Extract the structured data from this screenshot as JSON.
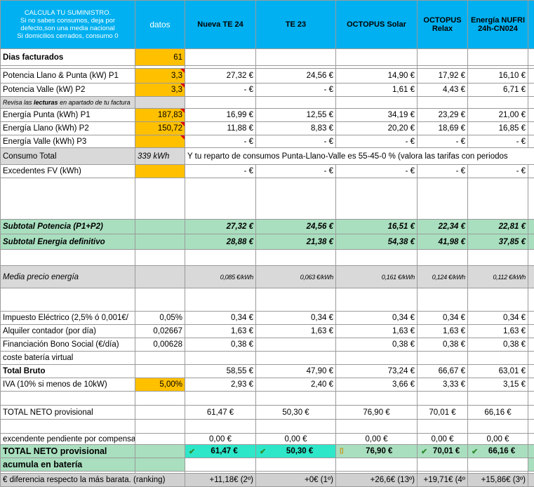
{
  "header": {
    "intro_lines": [
      "CALCULA TU SUMINISTRO.",
      "Si no sabes consumos, deja por",
      "defecto,son una media nacional",
      "Si domicilios cerrados, consumo 0"
    ],
    "datos": "datos",
    "providers": [
      "Nueva TE 24",
      "TE 23",
      "OCTOPUS  Solar",
      "OCTOPUS Relax",
      "Energía NUFRI 24h-CN024"
    ]
  },
  "rows": {
    "dias": {
      "label": "Dias facturados",
      "value": "61"
    },
    "p1": {
      "label": "Potencia Llano & Punta (kW) P1",
      "value": "3,3",
      "prices": [
        "27,32 €",
        "24,56 €",
        "14,90 €",
        "17,92 €",
        "16,10 €"
      ]
    },
    "p2": {
      "label": "Potencia Valle (kW) P2",
      "value": "3,3",
      "prices": [
        "-      €",
        "-      €",
        "1,61 €",
        "4,43 €",
        "6,71 €"
      ]
    },
    "note": {
      "prefix": "Revisa las",
      "bold": "lecturas",
      "suffix": "en apartado de tu factura"
    },
    "e1": {
      "label": "Energía Punta (kWh) P1",
      "value": "187,83",
      "prices": [
        "16,99 €",
        "12,55 €",
        "34,19 €",
        "23,29 €",
        "21,00 €"
      ]
    },
    "e2": {
      "label": "Energía Llano (kWh) P2",
      "value": "150,72",
      "prices": [
        "11,88 €",
        "8,83 €",
        "20,20 €",
        "18,69 €",
        "16,85 €"
      ]
    },
    "e3": {
      "label": "Energía Valle (kWh) P3",
      "value": "",
      "prices": [
        "-      €",
        "-      €",
        "-      €",
        "-      €",
        "-      €"
      ]
    },
    "consumo": {
      "label": "Consumo Total",
      "kwh": "339 kWh",
      "text": "Y tu reparto de consumos Punta-Llano-Valle es 55-45-0 %    (valora las tarifas con periodos"
    },
    "excedentes": {
      "label": "Excedentes FV (kWh)",
      "value": "",
      "prices": [
        "-      €",
        "-      €",
        "-      €",
        "-      €",
        "-      €"
      ]
    },
    "subpot": {
      "label": "Subtotal Potencia (P1+P2)",
      "prices": [
        "27,32 €",
        "24,56 €",
        "16,51 €",
        "22,34 €",
        "22,81 €"
      ]
    },
    "subene": {
      "label": "Subtotal Energia definitivo",
      "prices": [
        "28,88 €",
        "21,38 €",
        "54,38 €",
        "41,98 €",
        "37,85 €"
      ]
    },
    "media": {
      "label": "Media precio energía",
      "prices": [
        "0,085 €/kWh",
        "0,063 €/kWh",
        "0,161 €/kWh",
        "0,124 €/kWh",
        "0,112 €/kWh"
      ]
    },
    "impuesto": {
      "label": "Impuesto Eléctrico (2,5% ó 0,001€/",
      "value": "0,05%",
      "prices": [
        "0,34 €",
        "0,34 €",
        "0,34 €",
        "0,34 €",
        "0,34 €"
      ]
    },
    "alquiler": {
      "label": "Alquiler contador (por día)",
      "value": "0,02667",
      "prices": [
        "1,63 €",
        "1,63 €",
        "1,63 €",
        "1,63 €",
        "1,63 €"
      ]
    },
    "bono": {
      "label": "Financiación Bono Social (€/día)",
      "value": "0,00628",
      "prices": [
        "0,38 €",
        "",
        "0,38 €",
        "0,38 €",
        "0,38 €"
      ]
    },
    "bateria": {
      "label": "coste batería virtual"
    },
    "bruto": {
      "label": "Total Bruto",
      "prices": [
        "58,55 €",
        "47,90 €",
        "73,24 €",
        "66,67 €",
        "63,01 €"
      ]
    },
    "iva": {
      "label": "IVA (10% si menos de 10kW)",
      "value": "5,00%",
      "prices": [
        "2,93 €",
        "2,40 €",
        "3,66 €",
        "3,33 €",
        "3,15 €"
      ]
    },
    "neto1": {
      "label": "TOTAL NETO provisional",
      "prices": [
        "61,47 €",
        "50,30 €",
        "76,90 €",
        "70,01 €",
        "66,16 €"
      ]
    },
    "excedente_pend": {
      "label": "excendente pendiente por compensar",
      "prices": [
        "0,00 €",
        "0,00 €",
        "0,00 €",
        "0,00 €",
        "0,00 €"
      ]
    },
    "neto2": {
      "label": "TOTAL NETO provisional",
      "prices": [
        "61,47 €",
        "50,30 €",
        "76,90 €",
        "70,01 €",
        "66,16 €"
      ],
      "icons": [
        "check-icon",
        "check-icon",
        "warning-icon",
        "check-icon",
        "check-icon"
      ]
    },
    "acumula": {
      "label": "acumula en batería"
    },
    "ranking": {
      "label": "€ diferencia respecto la más barata. (ranking)",
      "values": [
        "+11,18€ (2º)",
        "+0€ (1º)",
        "+26,6€ (13º)",
        "+19,71€ (4º",
        "+15,86€ (3º)"
      ]
    }
  },
  "colors": {
    "header": "#00b0f0",
    "input": "#ffc000",
    "subtotal": "#a9dfbf",
    "gray": "#d9d9d9",
    "best": "#2ee6c8"
  }
}
